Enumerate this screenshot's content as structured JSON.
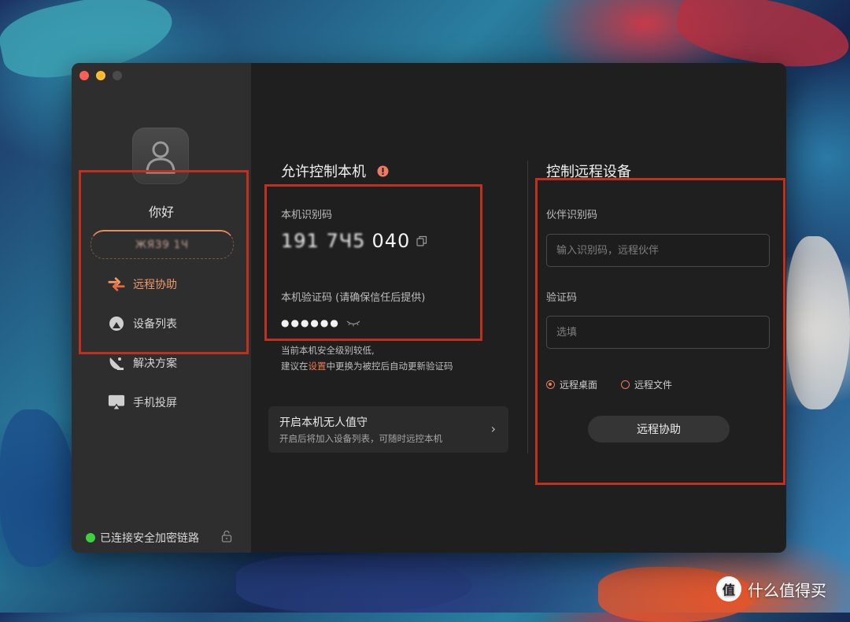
{
  "sidebar": {
    "greeting": "你好",
    "user_id_blurred": "ЖЯЗ9 1Ч",
    "nav": [
      {
        "label": "远程协助",
        "icon": "swap-arrows-icon",
        "active": true
      },
      {
        "label": "设备列表",
        "icon": "device-list-icon",
        "active": false
      },
      {
        "label": "解决方案",
        "icon": "satellite-dish-icon",
        "active": false
      },
      {
        "label": "手机投屏",
        "icon": "screen-cast-icon",
        "active": false
      }
    ],
    "status": "已连接安全加密链路"
  },
  "allow": {
    "title": "允许控制本机",
    "id_label": "本机识别码",
    "id_value_blurred": "191 7Ч5",
    "id_value_suffix": "040",
    "code_label": "本机验证码 (请确保信任后提供)",
    "code_masked": "●●●●●●",
    "hint_line1": "当前本机安全级别较低,",
    "hint_prefix": "建议在",
    "hint_link": "设置",
    "hint_suffix": "中更换为被控后自动更新验证码",
    "unattended_title": "开启本机无人值守",
    "unattended_sub": "开启后将加入设备列表，可随时远控本机"
  },
  "remote": {
    "title": "控制远程设备",
    "partner_label": "伙伴识别码",
    "partner_placeholder": "输入识别码，远程伙伴",
    "code_label": "验证码",
    "code_placeholder": "选填",
    "mode_desktop": "远程桌面",
    "mode_file": "远程文件",
    "selected_mode": "远程桌面",
    "button": "远程协助"
  },
  "watermark": {
    "badge": "值",
    "text": "什么值得买"
  },
  "colors": {
    "accent": "#e97b55",
    "highlight_box": "#c0301f",
    "status_green": "#3dd13d"
  }
}
